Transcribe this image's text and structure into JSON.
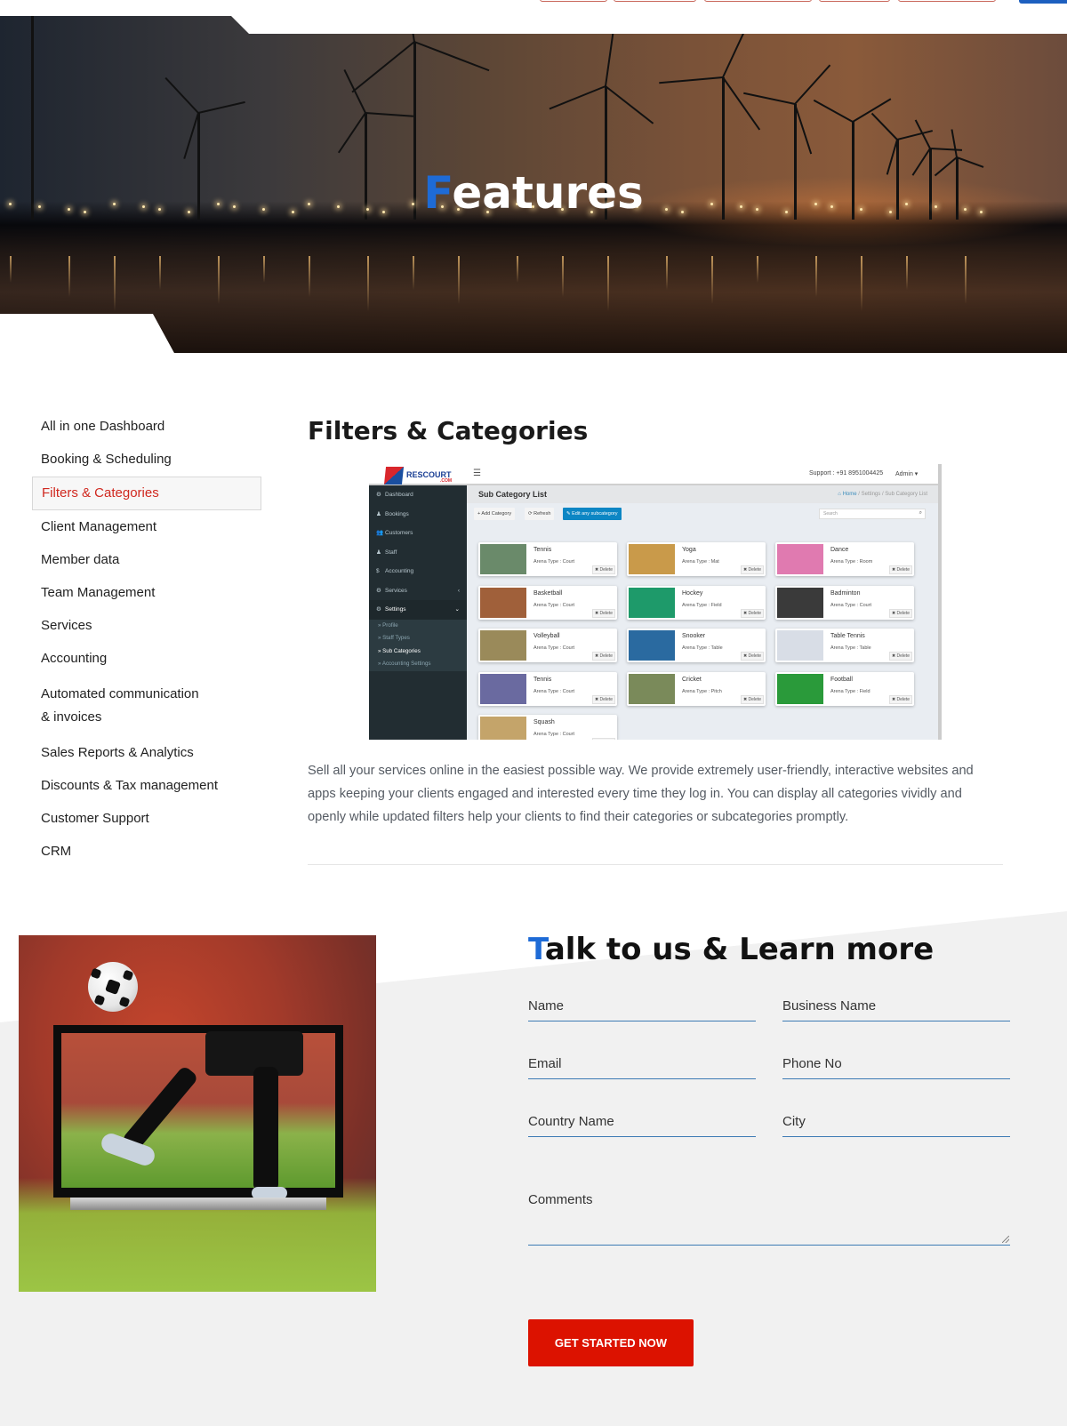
{
  "hero": {
    "title_first_letter": "F",
    "title_rest": "eatures"
  },
  "sidebar": {
    "items": [
      {
        "label": "All in one Dashboard",
        "active": false
      },
      {
        "label": "Booking & Scheduling",
        "active": false
      },
      {
        "label": "Filters & Categories",
        "active": true
      },
      {
        "label": "Client Management",
        "active": false
      },
      {
        "label": "Member data",
        "active": false
      },
      {
        "label": "Team Management",
        "active": false
      },
      {
        "label": "Services",
        "active": false
      },
      {
        "label": "Accounting",
        "active": false
      },
      {
        "label": "Automated communication & invoices",
        "active": false
      },
      {
        "label": "Sales Reports & Analytics",
        "active": false
      },
      {
        "label": "Discounts & Tax management",
        "active": false
      },
      {
        "label": "Customer Support",
        "active": false
      },
      {
        "label": "CRM",
        "active": false
      }
    ]
  },
  "main": {
    "title": "Filters & Categories",
    "description": "Sell all your services online in the easiest possible way. We provide extremely user-friendly, interactive websites and apps keeping your clients engaged and interested every time they log in. You can display all categories vividly and openly while updated filters help your clients to find their categories or subcategories promptly."
  },
  "screenshot": {
    "logo_text": "RESCOURT",
    "logo_suffix": ".COM",
    "menu_icon": "☰",
    "support": "Support : +91 8951004425",
    "admin": "Admin ▾",
    "page_title": "Sub Category List",
    "breadcrumb": {
      "home": "Home",
      "settings": "Settings",
      "current": "Sub Category List",
      "sep": " / "
    },
    "buttons": {
      "add": "+ Add Category",
      "refresh": "⟳ Refresh",
      "edit": "✎ Edit any subcategory"
    },
    "search_placeholder": "Search",
    "nav": [
      {
        "icon": "⚙",
        "label": "Dashboard"
      },
      {
        "icon": "♟",
        "label": "Bookings"
      },
      {
        "icon": "👥",
        "label": "Customers"
      },
      {
        "icon": "♟",
        "label": "Staff"
      },
      {
        "icon": "$",
        "label": "Accounting"
      },
      {
        "icon": "⚙",
        "label": "Services",
        "chev": "‹"
      },
      {
        "icon": "⚙",
        "label": "Settings",
        "chev": "⌄"
      }
    ],
    "subnav": [
      {
        "label": "Profile",
        "active": false
      },
      {
        "label": "Staff Types",
        "active": false
      },
      {
        "label": "Sub Categories",
        "active": true
      },
      {
        "label": "Accounting Settings",
        "active": false
      }
    ],
    "delete_label": "✖ Delete",
    "cards": [
      {
        "name": "Tennis",
        "arena": "Arena Type : Court",
        "color": "#6a8a6a"
      },
      {
        "name": "Yoga",
        "arena": "Arena Type : Mat",
        "color": "#c99a4a"
      },
      {
        "name": "Dance",
        "arena": "Arena Type : Room",
        "color": "#e07ab0"
      },
      {
        "name": "Basketball",
        "arena": "Arena Type : Court",
        "color": "#a0603a"
      },
      {
        "name": "Hockey",
        "arena": "Arena Type : Field",
        "color": "#1e9a6a"
      },
      {
        "name": "Badminton",
        "arena": "Arena Type : Court",
        "color": "#3a3a3a"
      },
      {
        "name": "Volleyball",
        "arena": "Arena Type : Court",
        "color": "#9a8a5a"
      },
      {
        "name": "Snooker",
        "arena": "Arena Type : Table",
        "color": "#2a6aa0"
      },
      {
        "name": "Table Tennis",
        "arena": "Arena Type : Table",
        "color": "#d8dde6"
      },
      {
        "name": "Tennis",
        "arena": "Arena Type : Court",
        "color": "#6a6aa0"
      },
      {
        "name": "Cricket",
        "arena": "Arena Type : Pitch",
        "color": "#7a8a5a"
      },
      {
        "name": "Football",
        "arena": "Arena Type : Field",
        "color": "#2a9a3a"
      },
      {
        "name": "Squash",
        "arena": "Arena Type : Court",
        "color": "#c4a46a"
      }
    ]
  },
  "contact": {
    "title_first_letter": "T",
    "title_rest": "alk to us & Learn more",
    "fields": {
      "name": "Name",
      "business_name": "Business Name",
      "email": "Email",
      "phone": "Phone No",
      "country": "Country Name",
      "city": "City",
      "comments": "Comments"
    },
    "submit_label": "GET STARTED NOW"
  },
  "colors": {
    "accent_blue": "#1e6bd6",
    "active_red": "#d0281f",
    "cta_red": "#dc1200"
  }
}
